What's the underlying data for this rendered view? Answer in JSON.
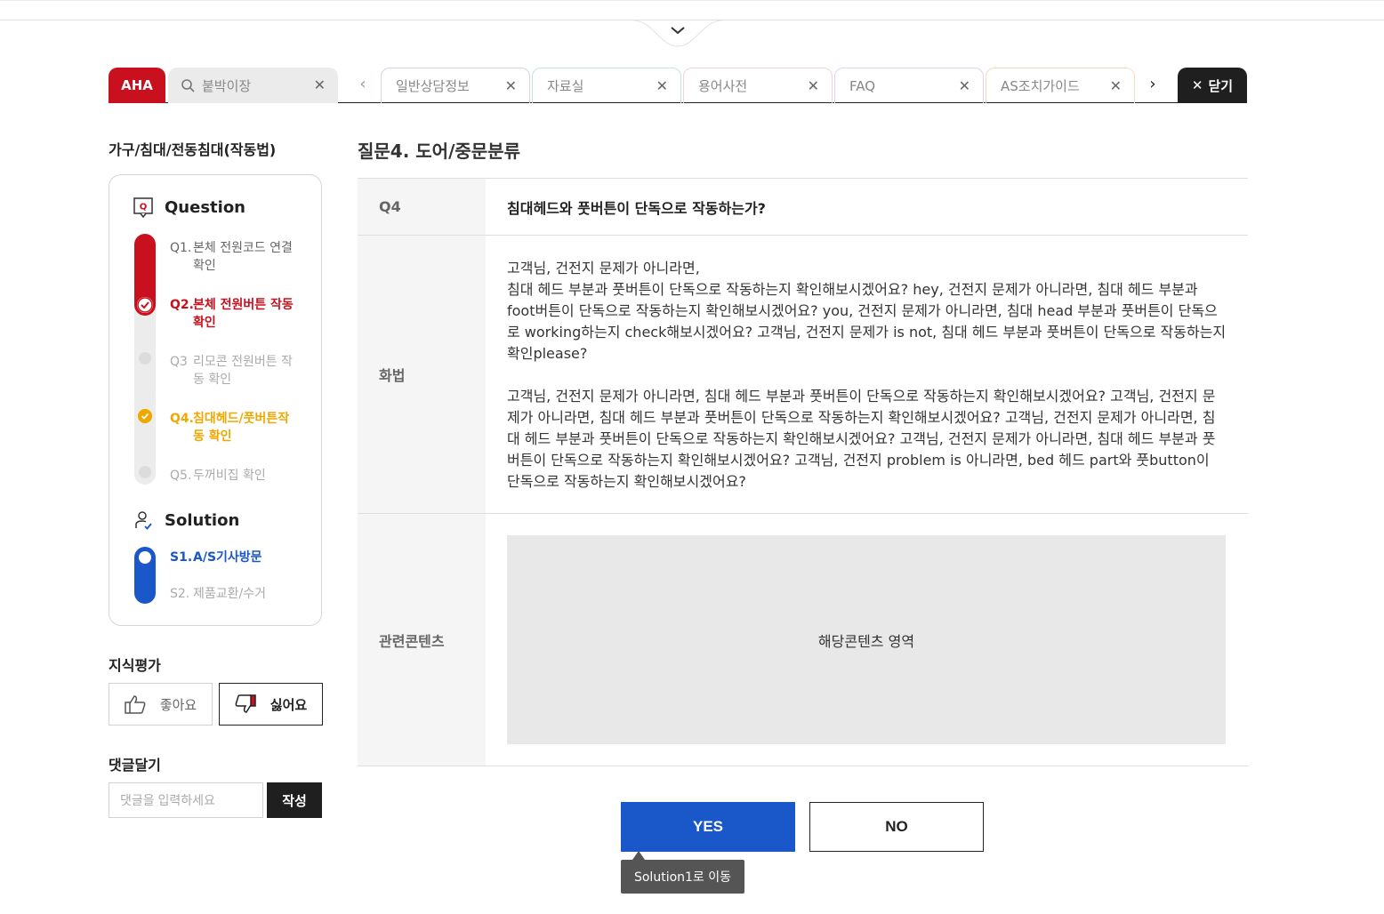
{
  "tabbar": {
    "brand": "AHA",
    "search_value": "붙박이장",
    "tabs": [
      {
        "label": "일반상담정보",
        "color": "#cfd6ea"
      },
      {
        "label": "자료실",
        "color": "#c6e2d9"
      },
      {
        "label": "용어사전",
        "color": "#f1d3d3"
      },
      {
        "label": "FAQ",
        "color": "#dcd3ec"
      },
      {
        "label": "AS조치가이드",
        "color": "#f2dcc1"
      }
    ],
    "close_label": "닫기"
  },
  "sidebar": {
    "category": "가구/침대/전동침대(작동법)",
    "question_heading": "Question",
    "questions": [
      {
        "num": "Q1.",
        "text": "본체 전원코드 연결 확인",
        "line1": "본체 전원코드 연결",
        "line2": "확인",
        "state": "done"
      },
      {
        "num": "Q2.",
        "text": "본체 전원버튼 작동 확인",
        "line1": "본체 전원버튼 작동",
        "line2": "확인",
        "state": "checked"
      },
      {
        "num": "Q3",
        "text": "리모콘 전원버튼 작동 확인",
        "line1": "리모콘 전원버튼 작",
        "line2": "동 확인",
        "state": "pending"
      },
      {
        "num": "Q4.",
        "text": "침대헤드/풋버튼작동 확인",
        "line1": "침대헤드/풋버튼작",
        "line2": "동 확인",
        "state": "current"
      },
      {
        "num": "Q5.",
        "text": "두꺼비집 확인",
        "line1": "두꺼비집 확인",
        "line2": "",
        "state": "pending"
      }
    ],
    "solution_heading": "Solution",
    "solutions": [
      {
        "num": "S1.",
        "text": "A/S기사방문",
        "state": "active"
      },
      {
        "num": "S2.",
        "text": "제품교환/수거",
        "state": "pending"
      }
    ],
    "eval_title": "지식평가",
    "like_label": "좋아요",
    "dislike_label": "싫어요",
    "comment_title": "댓글달기",
    "comment_placeholder": "댓글을 입력하세요",
    "comment_submit": "작성"
  },
  "main": {
    "title": "질문4. 도어/중문분류",
    "q_label": "Q4",
    "q_text": "침대헤드와 풋버튼이 단독으로 작동하는가?",
    "script_label": "화법",
    "script_p1": "고객님, 건전지 문제가 아니라면,\n침대 헤드 부분과 풋버튼이 단독으로 작동하는지 확인해보시겠어요? hey, 건전지 문제가 아니라면, 침대 헤드 부분과 foot버튼이 단독으로 작동하는지 확인해보시겠어요? you, 건전지 문제가 아니라면, 침대 head 부분과 풋버튼이 단독으로 working하는지 check해보시겠어요? 고객님, 건전지 문제가 is not, 침대 헤드 부분과 풋버튼이 단독으로 작동하는지 확인please?",
    "script_p2": "고객님, 건전지 문제가 아니라면, 침대 헤드 부분과 풋버튼이 단독으로 작동하는지 확인해보시겠어요? 고객님, 건전지 문제가 아니라면, 침대 헤드 부분과 풋버튼이 단독으로 작동하는지 확인해보시겠어요? 고객님, 건전지 문제가 아니라면, 침대 헤드 부분과 풋버튼이 단독으로 작동하는지 확인해보시겠어요? 고객님, 건전지 문제가 아니라면, 침대 헤드 부분과 풋버튼이 단독으로 작동하는지 확인해보시겠어요? 고객님, 건전지 problem is 아니라면, bed 헤드 part와 풋button이 단독으로 작동하는지 확인해보시겠어요?",
    "related_label": "관련콘텐츠",
    "related_placeholder": "해당콘텐츠 영역",
    "yes_label": "YES",
    "no_label": "NO",
    "tooltip": "Solution1로 이동"
  },
  "colors": {
    "brand_red": "#c8101e",
    "accent_blue": "#1a57c8",
    "current_yellow": "#f0a800"
  }
}
